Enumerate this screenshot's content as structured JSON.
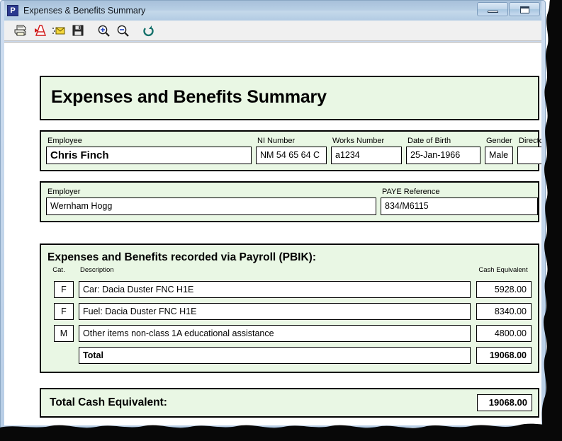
{
  "window": {
    "title": "Expenses & Benefits Summary",
    "app_icon": "P",
    "buttons": [
      {
        "name": "minimize",
        "glyph": "minimize-icon"
      },
      {
        "name": "maximize",
        "glyph": "maximize-icon"
      }
    ]
  },
  "toolbar": {
    "items": [
      {
        "name": "print-icon",
        "label": "Print"
      },
      {
        "name": "export-pdf-icon",
        "label": "Export to PDF"
      },
      {
        "name": "email-icon",
        "label": "Email"
      },
      {
        "name": "save-icon",
        "label": "Save"
      },
      {
        "name": "zoom-in-icon",
        "label": "Zoom In"
      },
      {
        "name": "zoom-out-icon",
        "label": "Zoom Out"
      },
      {
        "name": "refresh-icon",
        "label": "Refresh"
      }
    ]
  },
  "report": {
    "title": "Expenses and Benefits Summary",
    "employee": {
      "employee_label": "Employee",
      "employee_value": "Chris Finch",
      "ni_label": "NI Number",
      "ni_value": "NM 54 65 64 C",
      "works_label": "Works Number",
      "works_value": "a1234",
      "dob_label": "Date of Birth",
      "dob_value": "25-Jan-1966",
      "gender_label": "Gender",
      "gender_value": "Male",
      "director_label": "Director",
      "director_value": ""
    },
    "employer": {
      "employer_label": "Employer",
      "employer_value": "Wernham Hogg",
      "paye_label": "PAYE Reference",
      "paye_value": "834/M6115"
    },
    "pbik": {
      "heading": "Expenses and Benefits recorded via Payroll (PBIK):",
      "columns": {
        "cat": "Cat.",
        "description": "Description",
        "cash_equivalent": "Cash Equivalent"
      },
      "rows": [
        {
          "cat": "F",
          "description": "Car: Dacia Duster FNC H1E",
          "cash": "5928.00"
        },
        {
          "cat": "F",
          "description": "Fuel: Dacia Duster FNC H1E",
          "cash": "8340.00"
        },
        {
          "cat": "M",
          "description": "Other items non-class 1A educational assistance",
          "cash": "4800.00"
        }
      ],
      "total_label": "Total",
      "total_value": "19068.00"
    },
    "grand_total": {
      "label": "Total Cash Equivalent:",
      "value": "19068.00"
    }
  },
  "colors": {
    "panel_green": "#e9f7e4",
    "border": "#000000",
    "titlebar_blue": "#b7cee4"
  }
}
